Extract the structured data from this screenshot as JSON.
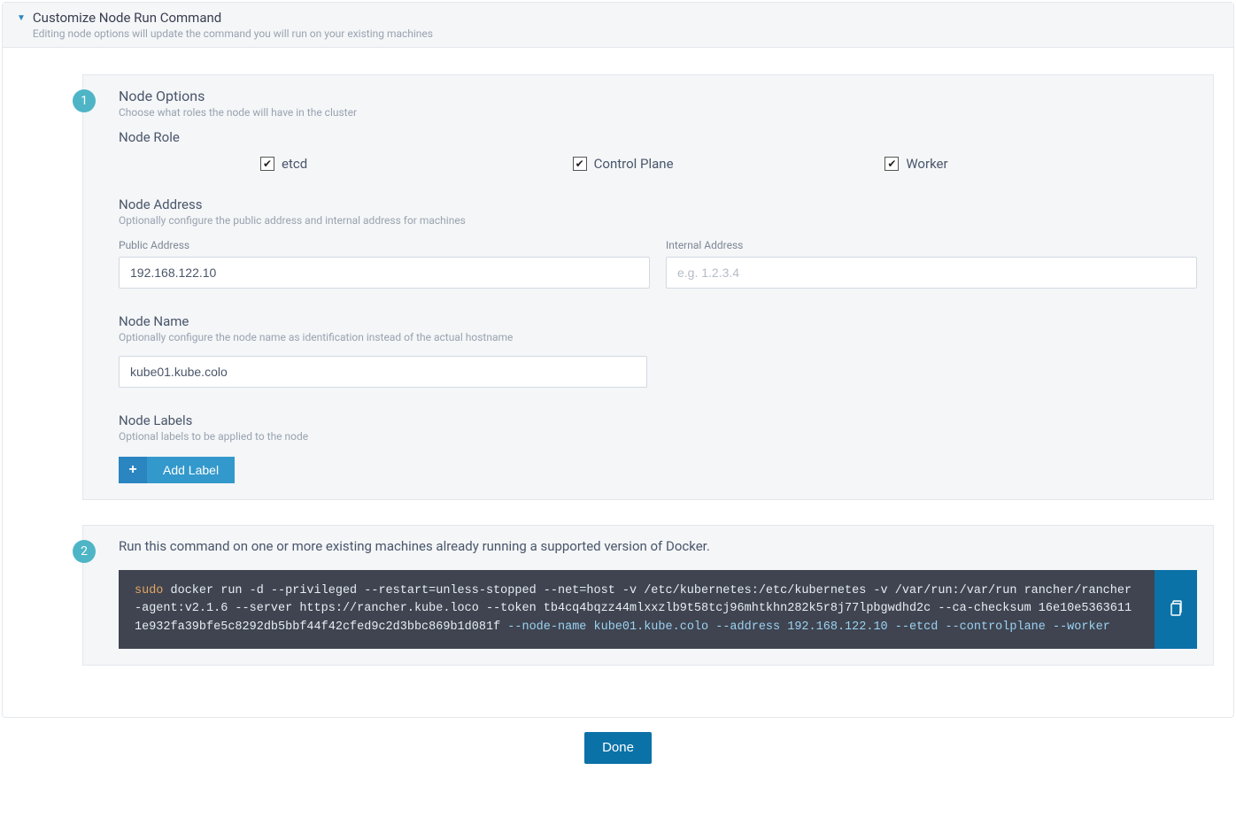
{
  "header": {
    "title": "Customize Node Run Command",
    "subtitle": "Editing node options will update the command you will run on your existing machines"
  },
  "step1": {
    "badge": "1",
    "title": "Node Options",
    "subtitle": "Choose what roles the node will have in the cluster",
    "nodeRoleLabel": "Node Role",
    "roles": {
      "etcd": "etcd",
      "controlPlane": "Control Plane",
      "worker": "Worker"
    },
    "nodeAddress": {
      "title": "Node Address",
      "subtitle": "Optionally configure the public address and internal address for machines",
      "publicLabel": "Public Address",
      "publicValue": "192.168.122.10",
      "internalLabel": "Internal Address",
      "internalPlaceholder": "e.g. 1.2.3.4"
    },
    "nodeName": {
      "title": "Node Name",
      "subtitle": "Optionally configure the node name as identification instead of the actual hostname",
      "value": "kube01.kube.colo"
    },
    "nodeLabels": {
      "title": "Node Labels",
      "subtitle": "Optional labels to be applied to the node",
      "addButton": "Add Label"
    }
  },
  "step2": {
    "badge": "2",
    "title": "Run this command on one or more existing machines already running a supported version of Docker.",
    "cmd_part1": "sudo",
    "cmd_part2": " docker run -d --privileged --restart=unless-stopped --net=host -v /etc/kubernetes:/etc/kubernetes -v /var/run:/var/run rancher/rancher-agent:v2.1.6 --server https://rancher.kube.loco --token tb4cq4bqzz44mlxxzlb9t58tcj96mhtkhn282k5r8j77lpbgwdhd2c --ca-checksum 16e10e53636111e932fa39bfe5c8292db5bbf44f42cfed9c2d3bbc869b1d081f ",
    "cmd_part3": "--node-name kube01.kube.colo --address 192.168.122.10 --etcd --controlplane --worker"
  },
  "doneButton": "Done"
}
